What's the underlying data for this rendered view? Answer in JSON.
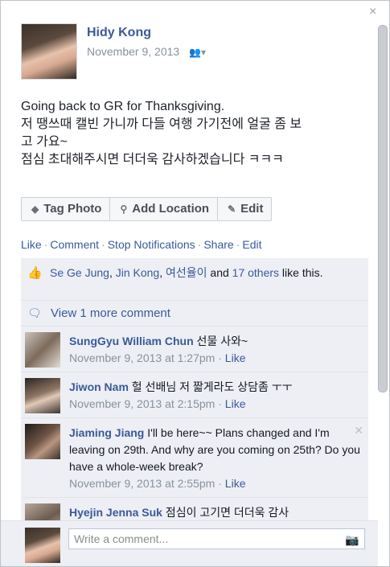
{
  "post": {
    "author": "Hidy Kong",
    "date": "November 9, 2013",
    "caption": [
      "Going back to GR for Thanksgiving.",
      "저 땡쓰때 캘빈 가니까 다들 여행 가기전에 얼굴 좀 보",
      "고 가요~",
      "점심 초대해주시면 더더욱 감사하겠습니다 ㅋㅋㅋ"
    ]
  },
  "photo_actions": {
    "tag": "Tag Photo",
    "location": "Add Location",
    "edit": "Edit"
  },
  "action_links": [
    "Like",
    "Comment",
    "Stop Notifications",
    "Share",
    "Edit"
  ],
  "likes": {
    "names": [
      "Se Ge Jung",
      "Jin Kong",
      "여선율이"
    ],
    "conjunction": "and",
    "others": "17 others",
    "suffix": "like this."
  },
  "view_more": "View 1 more comment",
  "comments": [
    {
      "author": "SungGyu William Chun",
      "text": "선물 사와~",
      "time": "November 9, 2013 at 1:27pm",
      "like": "Like"
    },
    {
      "author": "Jiwon Nam",
      "text": "헐 선배님 저 짧게라도 상담좀 ㅜㅜ",
      "time": "November 9, 2013 at 2:15pm",
      "like": "Like"
    },
    {
      "author": "Jiaming Jiang",
      "text": "I'll be here~~ Plans changed and I'm leaving on 29th. And why are you coming on 25th? Do you have a whole-week break?",
      "time": "November 9, 2013 at 2:55pm",
      "like": "Like"
    },
    {
      "author": "Hyejin Jenna Suk",
      "text": "점심이 고기면 더더욱 감사",
      "time": "",
      "like": ""
    }
  ],
  "composer": {
    "placeholder": "Write a comment..."
  },
  "icons": {
    "close": "close-icon",
    "audience": "friends-audience-icon",
    "tag": "tag-icon",
    "location": "map-pin-icon",
    "edit": "pencil-icon",
    "like": "thumbs-up-icon",
    "comment": "speech-bubble-icon",
    "camera": "camera-icon"
  },
  "colors": {
    "link": "#3b5998",
    "meta": "#89919c",
    "ufi_bg": "#edeff4"
  }
}
